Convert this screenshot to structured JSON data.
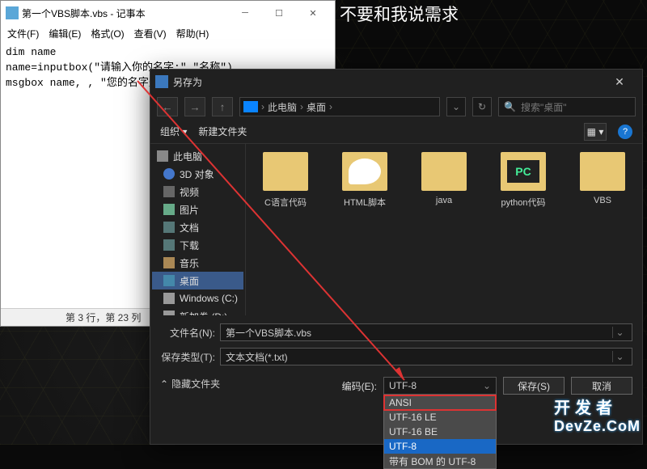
{
  "banner": "不要和我说需求",
  "notepad": {
    "title": "第一个VBS脚本.vbs - 记事本",
    "menu": {
      "file": "文件(F)",
      "edit": "编辑(E)",
      "format": "格式(O)",
      "view": "查看(V)",
      "help": "帮助(H)"
    },
    "code": "dim name\nname=inputbox(\"请输入你的名字:\",\"名称\")\nmsgbox name, , \"您的名字是\"",
    "status": "第 3 行，第 23 列"
  },
  "saveas": {
    "title": "另存为",
    "crumb1": "此电脑",
    "crumb2": "桌面",
    "search_placeholder": "搜索\"桌面\"",
    "organize": "组织 ▾",
    "newfolder": "新建文件夹",
    "tree": {
      "root": "此电脑",
      "threed": "3D 对象",
      "video": "视频",
      "pic": "图片",
      "doc": "文档",
      "dl": "下载",
      "music": "音乐",
      "desk": "桌面",
      "winc": "Windows (C:)",
      "newd": "新加卷 (D:)"
    },
    "files": {
      "c_code": "C语言代码",
      "html": "HTML脚本",
      "java": "java",
      "python": "python代码",
      "vbs": "VBS"
    },
    "filename_label": "文件名(N):",
    "filename_value": "第一个VBS脚本.vbs",
    "filetype_label": "保存类型(T):",
    "filetype_value": "文本文档(*.txt)",
    "hide_folders": "隐藏文件夹",
    "encoding_label": "编码(E):",
    "encoding_value": "UTF-8",
    "options": {
      "ansi": "ANSI",
      "utf16le": "UTF-16 LE",
      "utf16be": "UTF-16 BE",
      "utf8": "UTF-8",
      "utf8bom": "带有 BOM 的 UTF-8"
    },
    "save_btn": "保存(S)",
    "cancel_btn": "取消"
  },
  "watermark": {
    "cn": "开发者",
    "en": "DevZe.CoM"
  }
}
